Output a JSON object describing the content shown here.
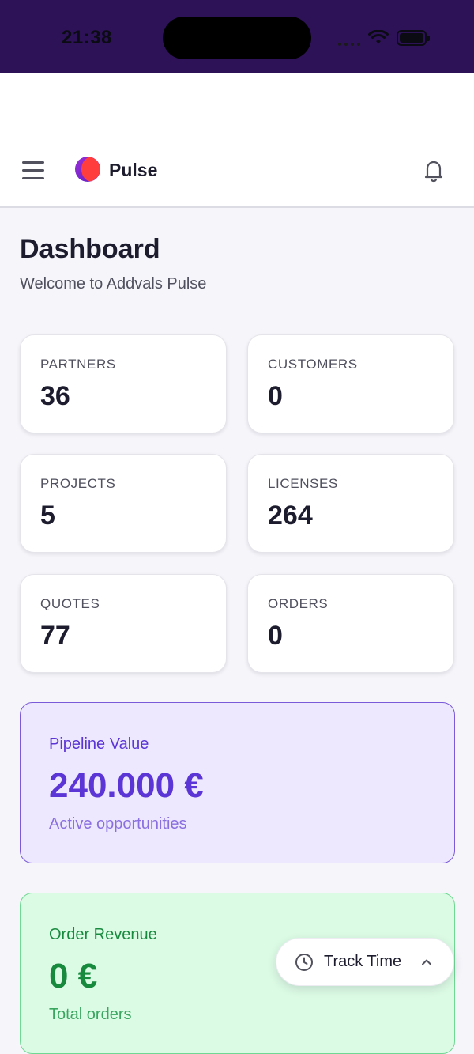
{
  "status_bar": {
    "time": "21:38",
    "icons": [
      "signal-icon",
      "wifi-icon",
      "battery-icon"
    ]
  },
  "header": {
    "brand_name": "Pulse",
    "icons": [
      "menu-icon",
      "logo-icon",
      "bell-icon"
    ]
  },
  "page": {
    "title": "Dashboard",
    "subtitle": "Welcome to Addvals Pulse"
  },
  "stats": [
    {
      "label": "PARTNERS",
      "value": "36"
    },
    {
      "label": "CUSTOMERS",
      "value": "0"
    },
    {
      "label": "PROJECTS",
      "value": "5"
    },
    {
      "label": "LICENSES",
      "value": "264"
    },
    {
      "label": "QUOTES",
      "value": "77"
    },
    {
      "label": "ORDERS",
      "value": "0"
    }
  ],
  "pipeline": {
    "title": "Pipeline Value",
    "value": "240.000 €",
    "subtitle": "Active opportunities"
  },
  "revenue": {
    "title": "Order Revenue",
    "value": "0 €",
    "subtitle": "Total orders"
  },
  "track_time": {
    "label": "Track Time"
  },
  "colors": {
    "status_bar": "#2e1258",
    "accent_purple": "#5b35d5",
    "pipeline_bg": "#ede8fd",
    "accent_green": "#178a3e",
    "revenue_bg": "#dcfbe5"
  }
}
